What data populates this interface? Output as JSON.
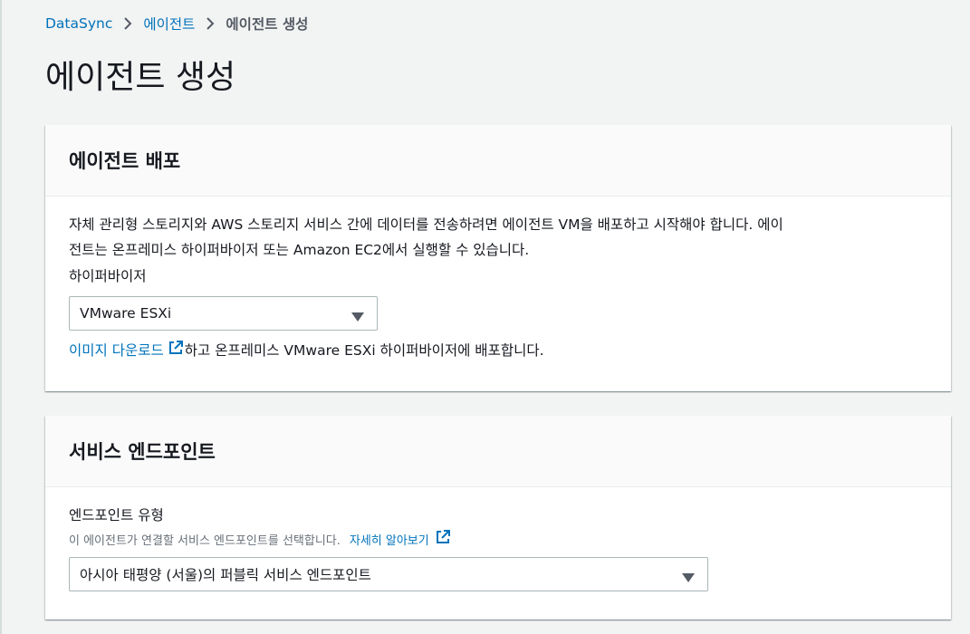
{
  "breadcrumb": {
    "items": [
      "DataSync",
      "에이전트"
    ],
    "current": "에이전트 생성"
  },
  "page": {
    "title": "에이전트 생성"
  },
  "deploy_panel": {
    "title": "에이전트 배포",
    "description_line1": "자체 관리형 스토리지와 AWS 스토리지 서비스 간에 데이터를 전송하려면 에이전트 VM을 배포하고 시작해야 합니다. 에이",
    "description_line2": "전트는 온프레미스 하이퍼바이저 또는 Amazon EC2에서 실행할 수 있습니다.",
    "hypervisor_label": "하이퍼바이저",
    "hypervisor_value": "VMware ESXi",
    "download_link": "이미지 다운로드",
    "download_suffix": "하고 온프레미스 VMware ESXi 하이퍼바이저에 배포합니다."
  },
  "endpoint_panel": {
    "title": "서비스 엔드포인트",
    "endpoint_type_label": "엔드포인트 유형",
    "endpoint_type_desc": "이 에이전트가 연결할 서비스 엔드포인트를 선택합니다.",
    "learn_more": "자세히 알아보기",
    "endpoint_type_value": "아시아 태평양 (서울)의 퍼블릭 서비스 엔드포인트"
  },
  "colors": {
    "link": "#0073bb",
    "background": "#f2f3f3",
    "panel_header": "#fafafa"
  },
  "icons": [
    "chevron-right-icon",
    "external-link-icon",
    "caret-down-icon"
  ]
}
